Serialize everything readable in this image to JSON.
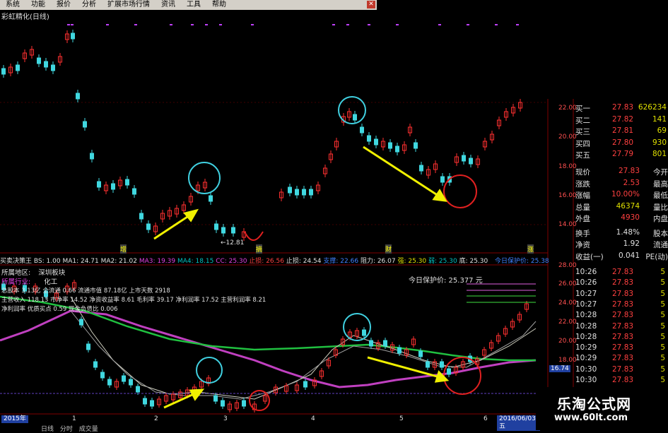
{
  "menu": {
    "items": [
      "系统",
      "功能",
      "报价",
      "分析",
      "扩展市场行情",
      "资讯",
      "工具",
      "帮助"
    ],
    "close_icon": "close-icon"
  },
  "main_chart": {
    "title": "彩虹精化(日线)",
    "label_low": "←12.81",
    "markers": [
      "增",
      "摘",
      "财",
      "涨"
    ],
    "price_ticks": [
      "22.00",
      "20.00",
      "18.00",
      "16.00",
      "14.00"
    ]
  },
  "indicator": {
    "name": "买卖决策王",
    "bs": "BS: 1.00",
    "ma1": "MA1: 24.71",
    "ma2": "MA2: 21.02",
    "ma3": "MA3: 19.39",
    "ma4": "MA4: 18.15",
    "cc": "CC: 25.30",
    "zhiying": "止损: 26.56",
    "zhiyingline": "止损: 24.54",
    "zhicheng": "支撑: 22.66",
    "zuli": "阻力: 26.07",
    "qiang": "强: 25.30",
    "ruo": "弱: 25.30",
    "di": "底: 25.30",
    "protect_label": "今日保护价: 25.38",
    "region": "所属地区:",
    "region_val": "深圳板块",
    "industry": "所属行业:",
    "industry_val": "化工",
    "info1": "总股本 3.13亿 全流通 0.66 流通市值 87.18亿 上市天数 2918",
    "info2": "主营收入 118.13 市净率 14.52 净资收益率 8.61 毛利率 39.17 净利润率 17.52 主营利润率 8.21",
    "info3": "净利润率 优质买点 0.59 现金负债比 0.006",
    "protect_price": "今日保护价: 25.377  元",
    "sub_ticks": [
      "28.00",
      "26.00",
      "24.00",
      "22.00",
      "20.00",
      "18.00"
    ],
    "tag_value": "16.74"
  },
  "quote": {
    "buy": [
      {
        "label": "买一",
        "price": "27.83",
        "vol": "626234"
      },
      {
        "label": "买二",
        "price": "27.82",
        "vol": "141"
      },
      {
        "label": "买三",
        "price": "27.81",
        "vol": "69"
      },
      {
        "label": "买四",
        "price": "27.80",
        "vol": "930"
      },
      {
        "label": "买五",
        "price": "27.79",
        "vol": "801"
      }
    ],
    "stats": [
      {
        "label": "现价",
        "value": "27.83",
        "label2": "今开"
      },
      {
        "label": "涨跌",
        "value": "2.53",
        "label2": "最高"
      },
      {
        "label": "涨幅",
        "value": "10.00%",
        "label2": "最低"
      },
      {
        "label": "总量",
        "value": "46374",
        "label2": "量比"
      },
      {
        "label": "外盘",
        "value": "4930",
        "label2": "内盘"
      },
      {
        "label": "换手",
        "value": "1.48%",
        "label2": "股本"
      },
      {
        "label": "净资",
        "value": "1.92",
        "label2": "流通"
      },
      {
        "label": "收益(一)",
        "value": "0.041",
        "label2": "PE(动)"
      }
    ],
    "ticks": [
      {
        "time": "10:26",
        "price": "27.83",
        "vol": "5"
      },
      {
        "time": "10:26",
        "price": "27.83",
        "vol": "5"
      },
      {
        "time": "10:27",
        "price": "27.83",
        "vol": "5"
      },
      {
        "time": "10:27",
        "price": "27.83",
        "vol": "5"
      },
      {
        "time": "10:28",
        "price": "27.83",
        "vol": "5"
      },
      {
        "time": "10:28",
        "price": "27.83",
        "vol": "5"
      },
      {
        "time": "10:28",
        "price": "27.83",
        "vol": "5"
      },
      {
        "time": "10:29",
        "price": "27.83",
        "vol": "5"
      },
      {
        "time": "10:29",
        "price": "27.83",
        "vol": "5"
      },
      {
        "time": "10:30",
        "price": "27.83",
        "vol": "5"
      },
      {
        "time": "10:30",
        "price": "27.83",
        "vol": "5"
      }
    ]
  },
  "timeline": {
    "start": "2015年",
    "end": "2016/06/03/五",
    "months": [
      "1",
      "2",
      "3",
      "4",
      "5",
      "6"
    ],
    "tabs": [
      "日线",
      "分时",
      "成交量"
    ]
  },
  "watermark": {
    "name": "乐淘公式网",
    "url": "www.60lt.com"
  }
}
